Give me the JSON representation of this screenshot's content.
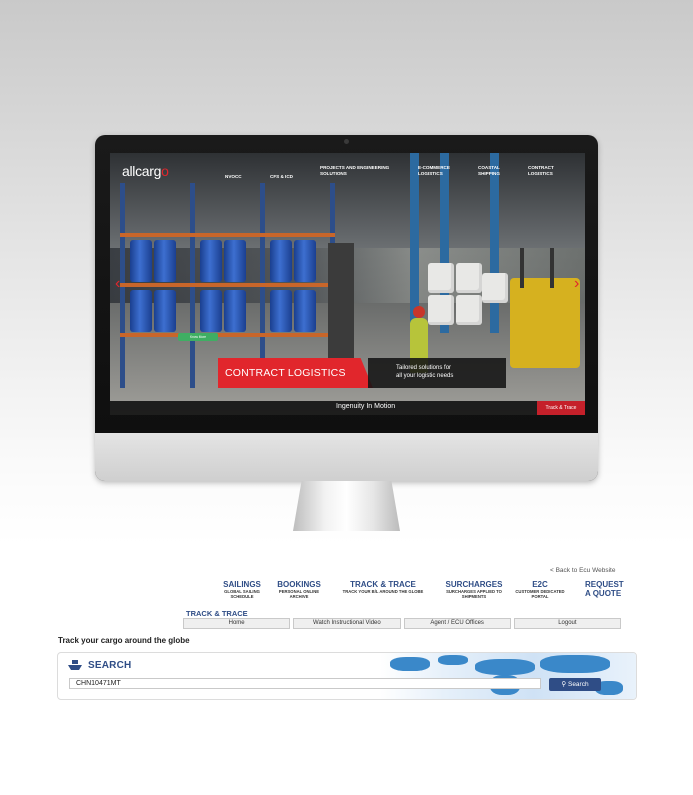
{
  "monitor": {
    "logo": {
      "part1": "all",
      "part2": "carg",
      "part3": "o"
    },
    "nav": [
      {
        "label": "NVOCC"
      },
      {
        "label": "CFS & ICD"
      },
      {
        "label": "PROJECTS AND ENGINEERING SOLUTIONS"
      },
      {
        "label": "E-COMMERCE LOGISTICS"
      },
      {
        "label": "COASTAL SHIPPING"
      },
      {
        "label": "CONTRACT LOGISTICS"
      }
    ],
    "arrow_prev": "‹",
    "arrow_next": "›",
    "green_button": "Know More",
    "banner_title": "CONTRACT LOGISTICS",
    "banner_text": "Tailored solutions for\nall your logistic needs",
    "tagline": "Ingenuity In Motion",
    "track_button": "Track & Trace"
  },
  "ecu": {
    "back_link": "< Back to Ecu Website",
    "menu": [
      {
        "title": "SAILINGS",
        "sub": "GLOBAL SAILING SCHEDULE"
      },
      {
        "title": "BOOKINGS",
        "sub": "PERSONAL ONLINE ARCHIVE"
      },
      {
        "title": "TRACK & TRACE",
        "sub": "TRACK YOUR B/L AROUND THE GLOBE"
      },
      {
        "title": "SURCHARGES",
        "sub": "SURCHARGES APPLIED TO SHIPMENTS"
      },
      {
        "title": "E2C",
        "sub": "CUSTOMER DEDICATED PORTAL"
      }
    ],
    "quote": "REQUEST\nA QUOTE",
    "section_label": "TRACK & TRACE",
    "tabs": [
      "Home",
      "Watch Instructional Video",
      "Agent / ECU Offices",
      "Logout"
    ],
    "heading": "Track your cargo around the globe",
    "search_title": "SEARCH",
    "search_value": "CHN10471MT",
    "search_button": "Search",
    "colors": {
      "brand_blue": "#2f4d86",
      "brand_red": "#e1262c"
    }
  }
}
